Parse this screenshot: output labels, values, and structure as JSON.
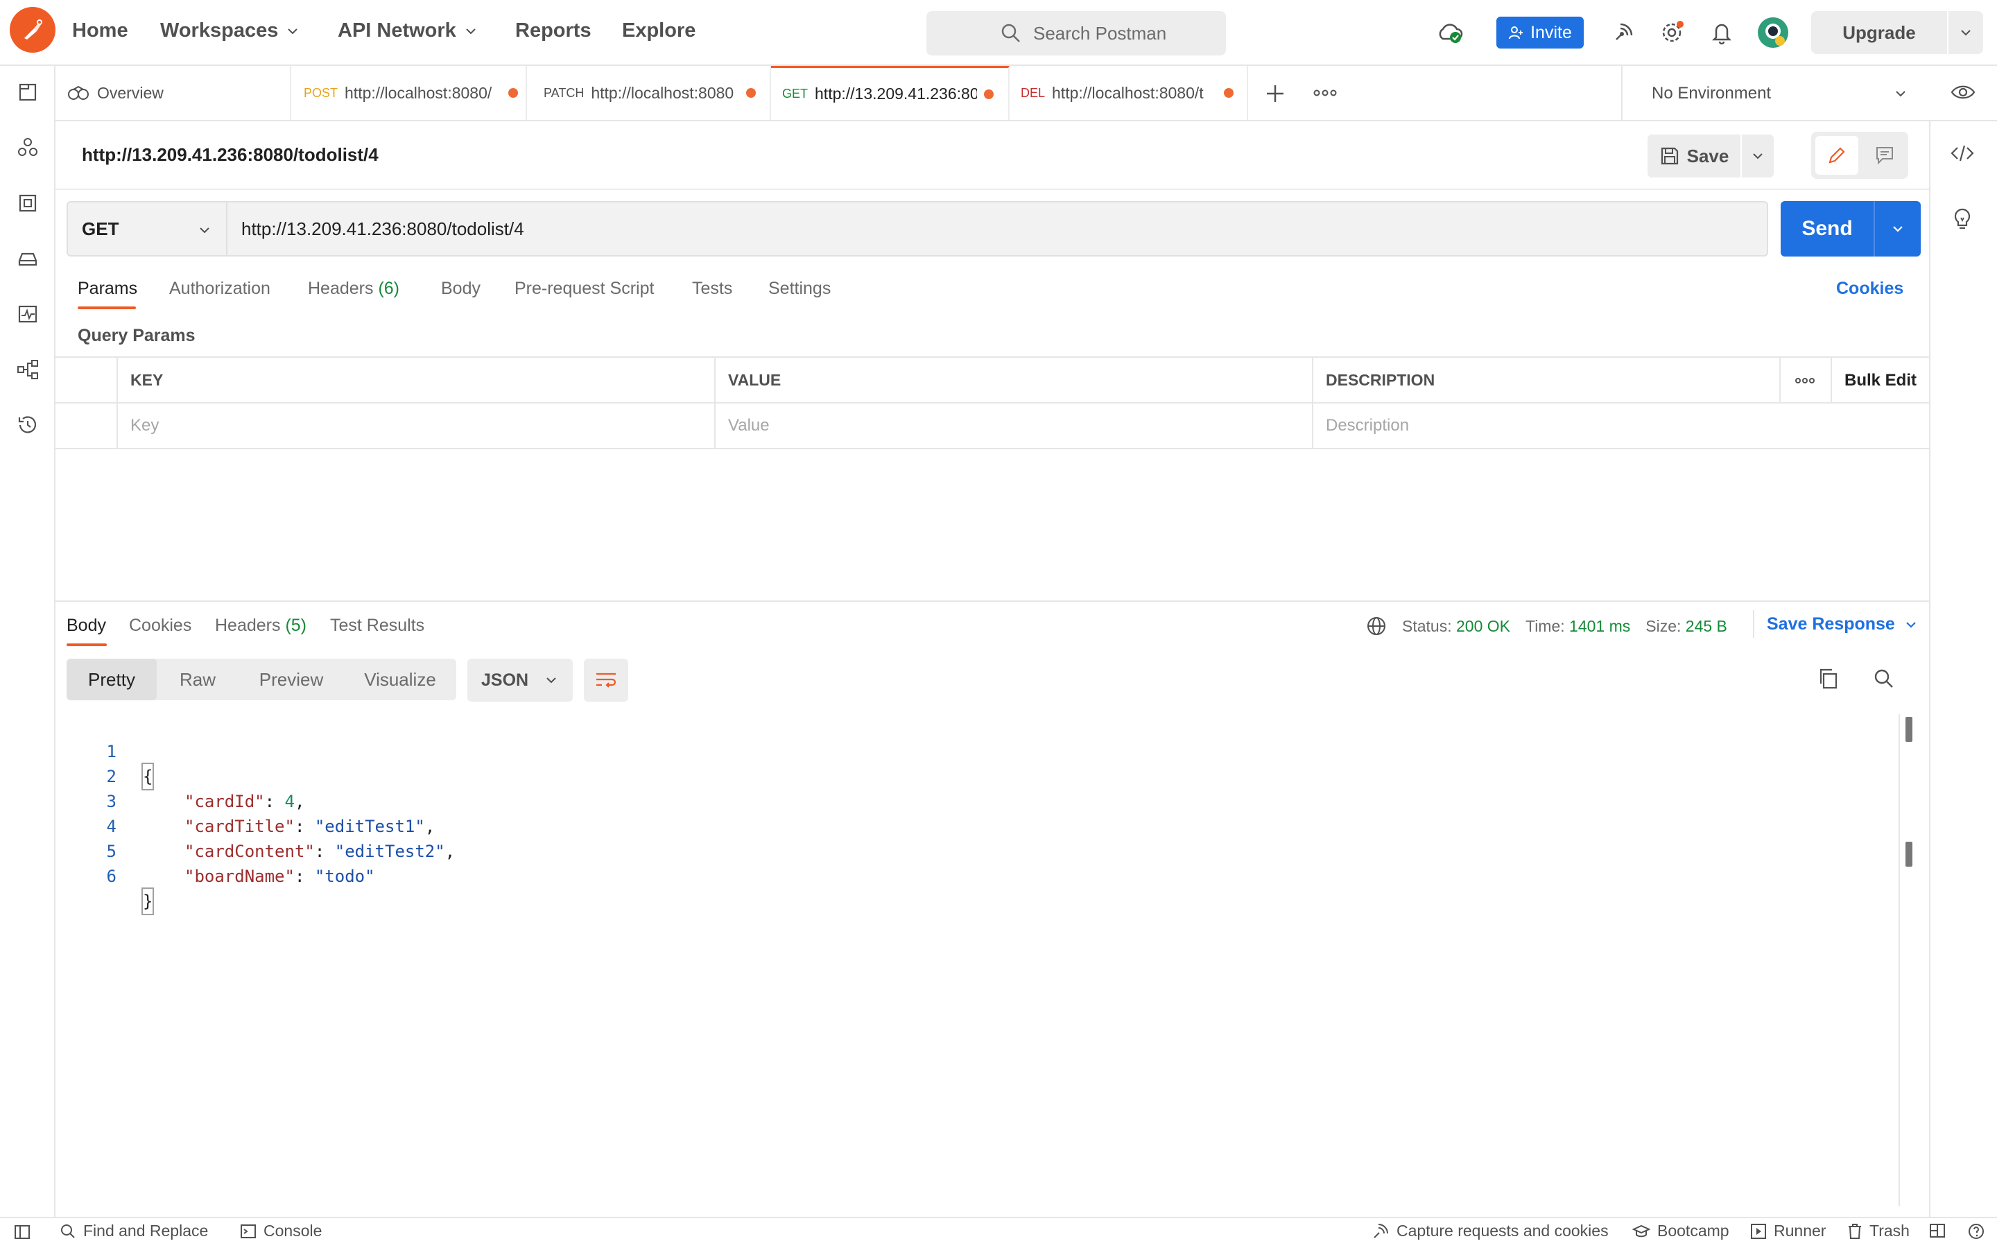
{
  "header": {
    "nav": [
      "Home",
      "Workspaces",
      "API Network",
      "Reports",
      "Explore"
    ],
    "search_placeholder": "Search Postman",
    "invite_label": "Invite",
    "upgrade_label": "Upgrade",
    "colors": {
      "brand": "#ef5b25",
      "primary": "#1f70e0",
      "success": "#168a38"
    }
  },
  "tabs": {
    "overview": "Overview",
    "items": [
      {
        "method": "POST",
        "url": "http://localhost:8080/",
        "method_color": "#e8a416"
      },
      {
        "method": "PATCH",
        "url": "http://localhost:8080",
        "method_color": "#505050"
      },
      {
        "method": "GET",
        "url": "http://13.209.41.236:80",
        "method_color": "#168a38"
      },
      {
        "method": "DEL",
        "url": "http://localhost:8080/t",
        "method_color": "#c62f2f"
      }
    ],
    "environment": "No Environment"
  },
  "request": {
    "title": "http://13.209.41.236:8080/todolist/4",
    "save_label": "Save",
    "method": "GET",
    "url": "http://13.209.41.236:8080/todolist/4",
    "send_label": "Send",
    "tabs": [
      "Params",
      "Authorization",
      "Headers",
      "Body",
      "Pre-request Script",
      "Tests",
      "Settings"
    ],
    "headers_count": "(6)",
    "cookies_label": "Cookies",
    "query_params_label": "Query Params",
    "table": {
      "columns": [
        "KEY",
        "VALUE",
        "DESCRIPTION"
      ],
      "bulk_edit": "Bulk Edit",
      "placeholders": [
        "Key",
        "Value",
        "Description"
      ]
    }
  },
  "response": {
    "tabs": [
      "Body",
      "Cookies",
      "Headers",
      "Test Results"
    ],
    "headers_count": "(5)",
    "status_label": "Status:",
    "status_value": "200 OK",
    "time_label": "Time:",
    "time_value": "1401 ms",
    "size_label": "Size:",
    "size_value": "245 B",
    "save_response": "Save Response",
    "view_modes": [
      "Pretty",
      "Raw",
      "Preview",
      "Visualize"
    ],
    "format": "JSON",
    "code_lines": [
      {
        "num": "1",
        "text": "{"
      },
      {
        "num": "2",
        "key": "\"cardId\"",
        "value": "4",
        "type": "number",
        "comma": ","
      },
      {
        "num": "3",
        "key": "\"cardTitle\"",
        "value": "\"editTest1\"",
        "type": "string",
        "comma": ","
      },
      {
        "num": "4",
        "key": "\"cardContent\"",
        "value": "\"editTest2\"",
        "type": "string",
        "comma": ","
      },
      {
        "num": "5",
        "key": "\"boardName\"",
        "value": "\"todo\"",
        "type": "string",
        "comma": ""
      },
      {
        "num": "6",
        "text": "}"
      }
    ]
  },
  "statusbar": {
    "find_replace": "Find and Replace",
    "console": "Console",
    "capture": "Capture requests and cookies",
    "bootcamp": "Bootcamp",
    "runner": "Runner",
    "trash": "Trash"
  }
}
